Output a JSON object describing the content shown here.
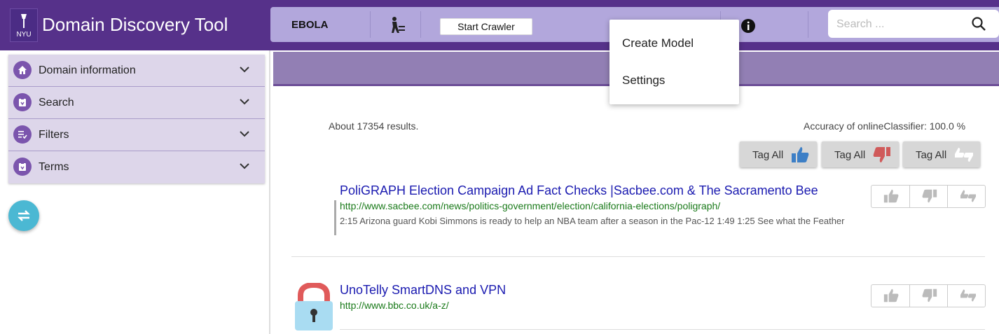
{
  "app": {
    "title": "Domain Discovery Tool",
    "logo_text": "NYU",
    "brand_color": "#56318a"
  },
  "toolbar": {
    "domain_name": "EBOLA",
    "crawl_icon": "crawler-icon",
    "start_crawler_label": "Start Crawler",
    "info_icon": "info-icon",
    "search_placeholder": "Search ..."
  },
  "dropdown_menu": {
    "items": [
      "Create Model",
      "Settings"
    ]
  },
  "sidebar": {
    "items": [
      {
        "label": "Domain information",
        "icon": "home-icon"
      },
      {
        "label": "Search",
        "icon": "clipboard-icon"
      },
      {
        "label": "Filters",
        "icon": "filter-list-icon"
      },
      {
        "label": "Terms",
        "icon": "clipboard-icon"
      }
    ],
    "fab_icon": "swap-icon"
  },
  "results": {
    "count_text": "About 17354 results.",
    "accuracy_text": "Accuracy of onlineClassifier: 100.0 %",
    "tag_all_buttons": [
      {
        "label": "Tag All",
        "icon": "thumb-up-icon",
        "color": "#3d7fc6"
      },
      {
        "label": "Tag All",
        "icon": "thumb-down-icon",
        "color": "#d05a5a"
      },
      {
        "label": "Tag All",
        "icon": "thumbs-neutral-icon",
        "color": "#ffffff"
      }
    ],
    "items": [
      {
        "title": "PoliGRAPH Election Campaign Ad Fact Checks |Sacbee.com & The Sacramento Bee",
        "url": "http://www.sacbee.com/news/politics-government/election/california-elections/poligraph/",
        "snippet": "2:15 Arizona guard Kobi Simmons is ready to help an NBA team after a season in the Pac-12 1:49 1:25 See what the Feather"
      },
      {
        "title": "UnoTelly SmartDNS and VPN",
        "url": "http://www.bbc.co.uk/a-z/",
        "snippet": ""
      }
    ]
  }
}
